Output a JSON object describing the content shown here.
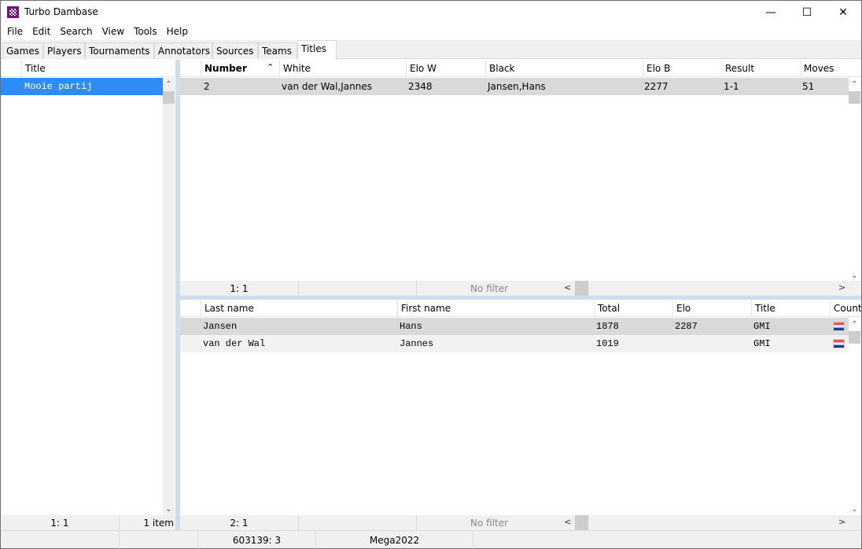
{
  "window": {
    "title": "Turbo Dambase",
    "controls": {
      "minimize": "—",
      "maximize": "☐",
      "close": "✕"
    }
  },
  "menu": [
    "File",
    "Edit",
    "Search",
    "View",
    "Tools",
    "Help"
  ],
  "tabs": [
    {
      "label": "Games",
      "active": false
    },
    {
      "label": "Players",
      "active": false
    },
    {
      "label": "Tournaments",
      "active": false
    },
    {
      "label": "Annotators",
      "active": false
    },
    {
      "label": "Sources",
      "active": false
    },
    {
      "label": "Teams",
      "active": false
    },
    {
      "label": "Titles",
      "active": true
    }
  ],
  "titles_list": {
    "header": "Title",
    "items": [
      {
        "title": "Mooie partij",
        "selected": true
      }
    ],
    "footer": {
      "position": "1: 1",
      "count": "1 item"
    }
  },
  "games_table": {
    "columns": [
      "Number",
      "White",
      "Elo W",
      "Black",
      "Elo B",
      "Result",
      "Moves"
    ],
    "sort_indicator": "^",
    "rows": [
      {
        "number": "2",
        "white": "van der Wal,Jannes",
        "elo_w": "2348",
        "black": "Jansen,Hans",
        "elo_b": "2277",
        "result": "1-1",
        "moves": "51"
      }
    ],
    "footer": {
      "position": "1: 1",
      "filter": "No filter"
    }
  },
  "players_table": {
    "columns": [
      "Last name",
      "First name",
      "Total",
      "Elo",
      "Title",
      "Country"
    ],
    "rows": [
      {
        "last": "Jansen",
        "first": "Hans",
        "total": "1878",
        "elo": "2287",
        "title": "GMI",
        "country": "netherlands-flag"
      },
      {
        "last": "van der Wal",
        "first": "Jannes",
        "total": "1019",
        "elo": "",
        "title": "GMI",
        "country": "netherlands-flag"
      }
    ],
    "footer": {
      "position": "2: 1",
      "filter": "No filter"
    }
  },
  "statusbar": {
    "cells": [
      "",
      "",
      "603139: 3",
      "Mega2022",
      ""
    ]
  },
  "colors": {
    "selection": "#2e8cf6",
    "row_highlight": "#d9d9d9",
    "splitter": "#cfdeed"
  }
}
